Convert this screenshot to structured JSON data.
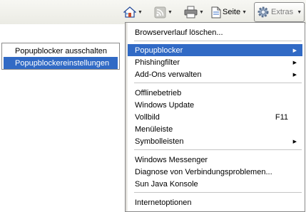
{
  "toolbar": {
    "home_icon": "home-icon",
    "feeds_icon": "rss-feed-icon",
    "print_icon": "printer-icon",
    "page_label": "Seite",
    "extras_label": "Extras"
  },
  "main_menu": {
    "items": [
      {
        "label": "Browserverlauf löschen..."
      },
      {
        "label": "Popupblocker"
      },
      {
        "label": "Phishingfilter"
      },
      {
        "label": "Add-Ons verwalten"
      },
      {
        "label": "Offlinebetrieb"
      },
      {
        "label": "Windows Update"
      },
      {
        "label": "Vollbild",
        "shortcut": "F11"
      },
      {
        "label": "Menüleiste"
      },
      {
        "label": "Symbolleisten"
      },
      {
        "label": "Windows Messenger"
      },
      {
        "label": "Diagnose von Verbindungsproblemen..."
      },
      {
        "label": "Sun Java Konsole"
      },
      {
        "label": "Internetoptionen"
      }
    ],
    "selected_index": 1
  },
  "sub_menu": {
    "items": [
      {
        "label": "Popupblocker ausschalten"
      },
      {
        "label": "Popupblockereinstellungen"
      }
    ],
    "selected_index": 1
  },
  "colors": {
    "selection": "#316ac5",
    "toolbar_bg": "#ebebe4"
  }
}
